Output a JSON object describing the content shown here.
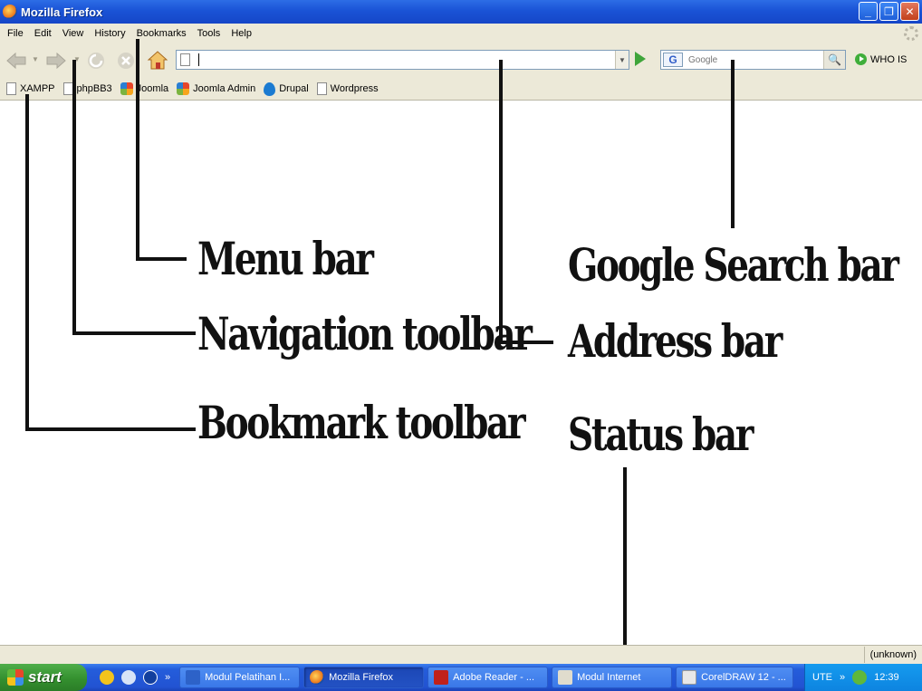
{
  "window": {
    "title": "Mozilla Firefox",
    "minimize": "_",
    "maximize": "❐",
    "close": "✕"
  },
  "menubar": {
    "items": [
      "File",
      "Edit",
      "View",
      "History",
      "Bookmarks",
      "Tools",
      "Help"
    ]
  },
  "navigation": {
    "address_value": "",
    "search_placeholder": "Google",
    "search_engine_icon": "G",
    "whois_label": "WHO IS"
  },
  "bookmarks": {
    "items": [
      "XAMPP",
      "phpBB3",
      "Joomla",
      "Joomla Admin",
      "Drupal",
      "Wordpress"
    ]
  },
  "annotations": {
    "menu_bar": "Menu bar",
    "navigation_toolbar": "Navigation toolbar",
    "bookmark_toolbar": "Bookmark toolbar",
    "google_search_bar": "Google Search bar",
    "address_bar": "Address bar",
    "status_bar": "Status bar"
  },
  "statusbar": {
    "right_text": "(unknown)"
  },
  "taskbar": {
    "start_label": "start",
    "quick_more": "»",
    "tasks": [
      "Modul Pelatihan I...",
      "Mozilla Firefox",
      "Adobe Reader - ...",
      "Modul Internet",
      "CorelDRAW 12 - ..."
    ],
    "tray_text": "UTE",
    "tray_more": "»",
    "clock": "12:39"
  },
  "colors": {
    "title_bar": "#1a53d6",
    "chrome": "#ece9d8",
    "taskbar": "#245ddb",
    "start_button": "#34902f",
    "tray": "#0d84e0"
  }
}
